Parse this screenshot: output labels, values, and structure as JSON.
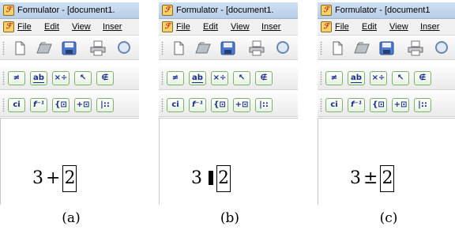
{
  "window": {
    "app_icon_glyph": "ℱ",
    "title": "Formulator - [document1.",
    "title_c": "Formulator - [document1"
  },
  "menu": {
    "file": "File",
    "edit": "Edit",
    "view": "View",
    "insert_partial": "Inser"
  },
  "standard_toolbar": [
    "new-document-icon",
    "open-folder-icon",
    "save-disk-icon",
    "print-icon",
    "print-preview-icon"
  ],
  "symbol_toolbar": {
    "not_equal": "≠",
    "ab_box": "ab",
    "times_divide": "×÷",
    "arrow": "↖",
    "not_element": "∉"
  },
  "template_toolbar": {
    "ci": "ci",
    "function": "f⁻¹",
    "brace": "{⊡",
    "plus_box": "+⊡",
    "bars": "|::"
  },
  "panels": [
    {
      "caption": "(a)",
      "formula_left": "3",
      "operator": "+",
      "slot": "2"
    },
    {
      "caption": "(b)",
      "formula_left": "3",
      "operator": "",
      "slot": "2"
    },
    {
      "caption": "(c)",
      "formula_left": "3",
      "operator": "±",
      "slot": "2"
    }
  ]
}
